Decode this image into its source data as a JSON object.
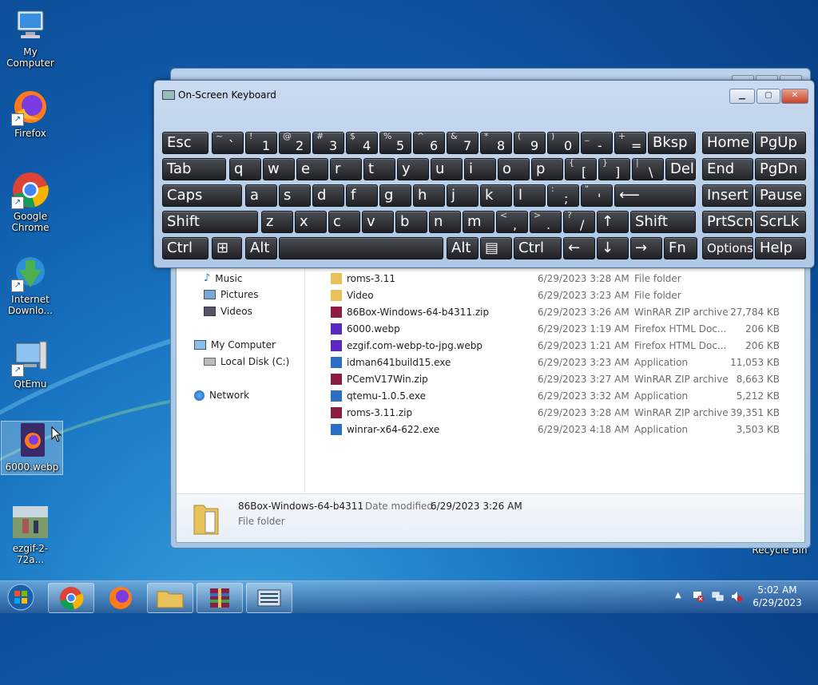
{
  "desktop": {
    "icons": [
      {
        "label": "My Computer"
      },
      {
        "label": "Firefox"
      },
      {
        "label": "Google Chrome"
      },
      {
        "label": "Internet Downlo..."
      },
      {
        "label": "QtEmu"
      },
      {
        "label": "6000.webp"
      },
      {
        "label": "ezgif-2-72a..."
      },
      {
        "label": "Recycle Bin"
      }
    ]
  },
  "osk": {
    "title": "On-Screen Keyboard",
    "row1": [
      "Esc",
      "~ `",
      "! 1",
      "@ 2",
      "# 3",
      "$ 4",
      "% 5",
      "^ 6",
      "& 7",
      "* 8",
      "( 9",
      ") 0",
      "_ -",
      "+ =",
      "Bksp",
      "Home",
      "PgUp"
    ],
    "row2": [
      "Tab",
      "q",
      "w",
      "e",
      "r",
      "t",
      "y",
      "u",
      "i",
      "o",
      "p",
      "{ [",
      "} ]",
      "| \\",
      "Del",
      "End",
      "PgDn"
    ],
    "row3": [
      "Caps",
      "a",
      "s",
      "d",
      "f",
      "g",
      "h",
      "j",
      "k",
      "l",
      ": ;",
      "\" '",
      "⟵",
      "Insert",
      "Pause"
    ],
    "row4": [
      "Shift",
      "z",
      "x",
      "c",
      "v",
      "b",
      "n",
      "m",
      "< ,",
      "> .",
      "? /",
      "↑",
      "Shift",
      "PrtScn",
      "ScrLk"
    ],
    "row5": [
      "Ctrl",
      "⊞",
      "Alt",
      "",
      "Alt",
      "▤",
      "Ctrl",
      "←",
      "↓",
      "→",
      "Fn",
      "Options",
      "Help"
    ]
  },
  "explorer": {
    "nav": [
      "Music",
      "Pictures",
      "Videos",
      "My Computer",
      "Local Disk (C:)",
      "Network"
    ],
    "files": [
      {
        "name": "roms-3.11",
        "date": "6/29/2023 3:28 AM",
        "type": "File folder",
        "size": ""
      },
      {
        "name": "Video",
        "date": "6/29/2023 3:23 AM",
        "type": "File folder",
        "size": ""
      },
      {
        "name": "86Box-Windows-64-b4311.zip",
        "date": "6/29/2023 3:26 AM",
        "type": "WinRAR ZIP archive",
        "size": "27,784 KB"
      },
      {
        "name": "6000.webp",
        "date": "6/29/2023 1:19 AM",
        "type": "Firefox HTML Doc...",
        "size": "206 KB"
      },
      {
        "name": "ezgif.com-webp-to-jpg.webp",
        "date": "6/29/2023 1:21 AM",
        "type": "Firefox HTML Doc...",
        "size": "206 KB"
      },
      {
        "name": "idman641build15.exe",
        "date": "6/29/2023 3:23 AM",
        "type": "Application",
        "size": "11,053 KB"
      },
      {
        "name": "PCemV17Win.zip",
        "date": "6/29/2023 3:27 AM",
        "type": "WinRAR ZIP archive",
        "size": "8,663 KB"
      },
      {
        "name": "qtemu-1.0.5.exe",
        "date": "6/29/2023 3:32 AM",
        "type": "Application",
        "size": "5,212 KB"
      },
      {
        "name": "roms-3.11.zip",
        "date": "6/29/2023 3:28 AM",
        "type": "WinRAR ZIP archive",
        "size": "39,351 KB"
      },
      {
        "name": "winrar-x64-622.exe",
        "date": "6/29/2023 4:18 AM",
        "type": "Application",
        "size": "3,503 KB"
      }
    ],
    "details": {
      "name": "86Box-Windows-64-b4311",
      "modified_label": "Date modified:",
      "modified": "6/29/2023 3:26 AM",
      "type": "File folder"
    }
  },
  "taskbar": {
    "time": "5:02 AM",
    "date": "6/29/2023"
  }
}
